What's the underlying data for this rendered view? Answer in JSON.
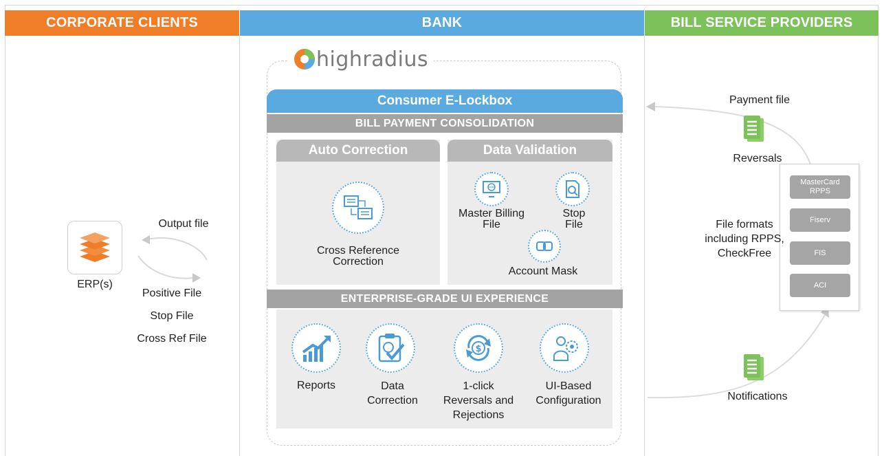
{
  "headers": {
    "corporate": "CORPORATE CLIENTS",
    "bank": "BANK",
    "providers": "BILL SERVICE PROVIDERS"
  },
  "colors": {
    "corporate": "#f07d27",
    "bank": "#5aa9df",
    "providers": "#7dc15b",
    "band_gray": "#a3a3a3",
    "panel_bg": "#ececec"
  },
  "corporate": {
    "erp_label": "ERP(s)",
    "output_file": "Output file",
    "files": [
      "Positive File",
      "Stop File",
      "Cross Ref File"
    ]
  },
  "bank": {
    "logo_text": "highradius",
    "product_title": "Consumer E-Lockbox",
    "consolidation_title": "BILL PAYMENT CONSOLIDATION",
    "auto_correction": {
      "title": "Auto Correction",
      "item": "Cross Reference Correction"
    },
    "data_validation": {
      "title": "Data Validation",
      "master_billing": "Master Billing File",
      "stop_file": "Stop File",
      "account_mask": "Account Mask"
    },
    "ui_title": "ENTERPRISE-GRADE UI EXPERIENCE",
    "ui_items": [
      {
        "label": "Reports",
        "icon": "chart-up-icon"
      },
      {
        "label": "Data Correction",
        "icon": "clipboard-check-icon"
      },
      {
        "label": "1-click Reversals and Rejections",
        "icon": "dollar-cycle-icon"
      },
      {
        "label": "UI-Based Configuration",
        "icon": "people-gear-icon"
      }
    ]
  },
  "providers": {
    "payment_file": "Payment file",
    "reversals": "Reversals",
    "formats": "File formats including RPPS, CheckFree",
    "notifications": "Notifications",
    "list": [
      "MasterCard RPPS",
      "Fiserv",
      "FIS",
      "ACI"
    ]
  }
}
